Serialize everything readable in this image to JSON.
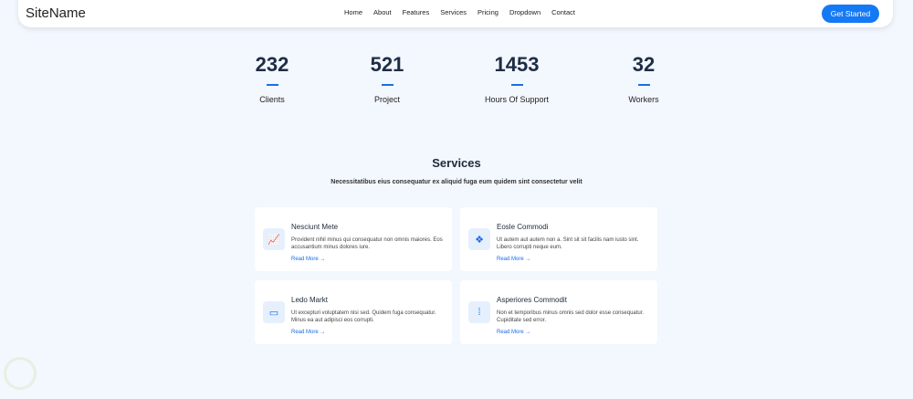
{
  "header": {
    "logo": "SiteName",
    "menu": [
      "Home",
      "About",
      "Features",
      "Services",
      "Pricing",
      "Dropdown",
      "Contact"
    ],
    "cta": "Get Started"
  },
  "stats": [
    {
      "value": "232",
      "label": "Clients"
    },
    {
      "value": "521",
      "label": "Project"
    },
    {
      "value": "1453",
      "label": "Hours Of Support"
    },
    {
      "value": "32",
      "label": "Workers"
    }
  ],
  "services": {
    "title": "Services",
    "subtitle": "Necessitatibus eius consequatur ex aliquid fuga eum quidem sint consectetur velit",
    "cards": [
      {
        "icon": "chart-line-icon",
        "glyph": "📈",
        "title": "Nesciunt Mete",
        "desc": "Provident nihil minus qui consequatur non omnis maiores. Eos accusantium minus dolores iure.",
        "link": "Read More →"
      },
      {
        "icon": "stack-icon",
        "glyph": "❖",
        "title": "Eosle Commodi",
        "desc": "Ut autem aut autem non a. Sint sit sit facilis nam iusto sint. Libero corrupti neque eum.",
        "link": "Read More →"
      },
      {
        "icon": "calendar-icon",
        "glyph": "▭",
        "title": "Ledo Markt",
        "desc": "Ut excepturi voluptatem nisi sed. Quidem fuga consequatur. Minus ea aut adipisci eos corrupti.",
        "link": "Read More →"
      },
      {
        "icon": "bar-chart-icon",
        "glyph": "⁞",
        "title": "Asperiores Commodit",
        "desc": "Non et temporibus minus omnis sed dolor esse consequatur. Cupiditate sed error.",
        "link": "Read More →"
      }
    ]
  }
}
